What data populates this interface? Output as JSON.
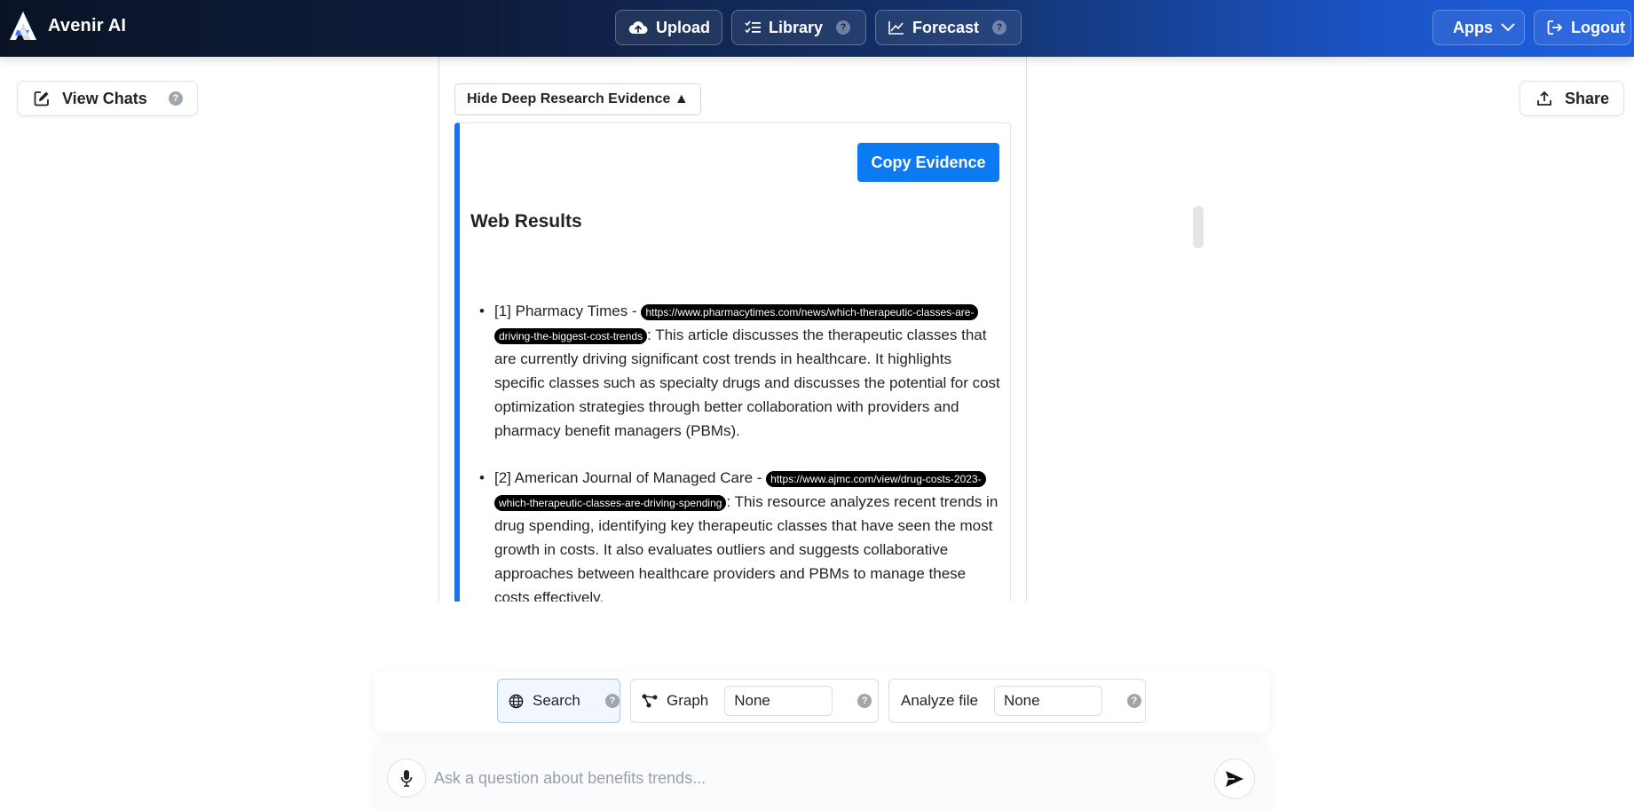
{
  "app": {
    "name": "Avenir AI",
    "logo_icon": "avenir-logo-icon"
  },
  "nav": {
    "upload": {
      "label": "Upload",
      "icon": "cloud-upload-icon"
    },
    "library": {
      "label": "Library",
      "icon": "list-checks-icon",
      "help": "?"
    },
    "forecast": {
      "label": "Forecast",
      "icon": "line-chart-icon",
      "help": "?"
    },
    "apps": {
      "label": "Apps",
      "icon": "chevron-down-icon"
    },
    "logout": {
      "label": "Logout",
      "icon": "logout-icon"
    }
  },
  "sidebar": {
    "view_chats": {
      "label": "View Chats",
      "icon": "edit-icon",
      "help": "?"
    }
  },
  "header_actions": {
    "share": {
      "label": "Share",
      "icon": "upload-share-icon"
    }
  },
  "evidence": {
    "toggle_label": "Hide Deep Research Evidence ▲",
    "copy_label": "Copy Evidence",
    "section_title": "Web Results",
    "results": [
      {
        "prefix": "[1] Pharmacy Times - ",
        "url": "https://www.pharmacytimes.com/news/which-therapeutic-classes-are-driving-the-biggest-cost-trends",
        "summary": ": This article discusses the therapeutic classes that are currently driving significant cost trends in healthcare. It highlights specific classes such as specialty drugs and discusses the potential for cost optimization strategies through better collaboration with providers and pharmacy benefit managers (PBMs)."
      },
      {
        "prefix": "[2] American Journal of Managed Care - ",
        "url": "https://www.ajmc.com/view/drug-costs-2023-which-therapeutic-classes-are-driving-spending",
        "summary": ": This resource analyzes recent trends in drug spending, identifying key therapeutic classes that have seen the most growth in costs. It also evaluates outliers and suggests collaborative approaches between healthcare providers and PBMs to manage these costs effectively."
      }
    ]
  },
  "tools": {
    "search": {
      "label": "Search",
      "icon": "globe-icon",
      "help": "?",
      "active": true
    },
    "graph": {
      "label": "Graph",
      "icon": "graph-nodes-icon",
      "value": "None",
      "help": "?"
    },
    "analyze": {
      "label": "Analyze file",
      "value": "None",
      "help": "?"
    }
  },
  "chat": {
    "placeholder": "Ask a question about benefits trends...",
    "mic_icon": "microphone-icon",
    "send_icon": "send-icon"
  },
  "colors": {
    "accent": "#1a73e8",
    "primary_button": "#0b7af3",
    "topbar_start": "#0a1326",
    "topbar_end": "#1d5fe0"
  }
}
